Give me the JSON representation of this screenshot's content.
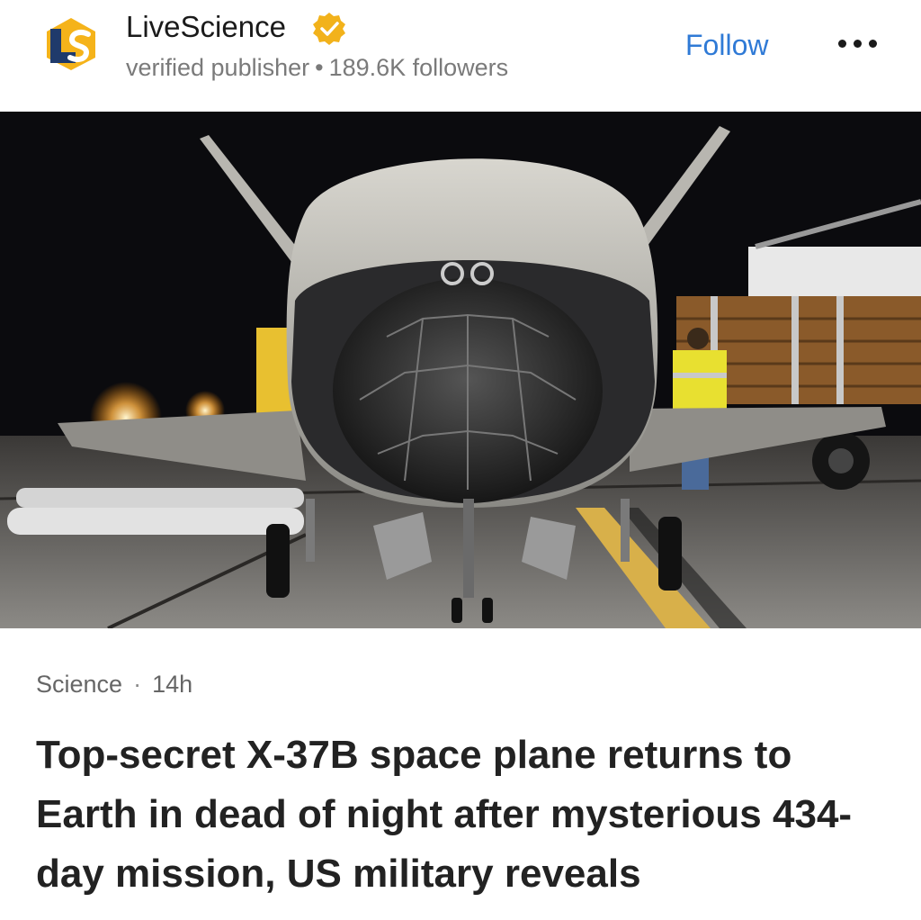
{
  "publisher": {
    "name": "LiveScience",
    "logo_icon": "livescience-logo",
    "verified_icon": "verified-badge-icon",
    "subtitle": "verified publisher",
    "separator": "•",
    "followers": "189.6K followers",
    "follow_label": "Follow",
    "more_icon": "more-horizontal-icon"
  },
  "image": {
    "description_icon": "article-hero-image"
  },
  "article": {
    "category": "Science",
    "separator": "·",
    "age": "14h",
    "headline": "Top-secret X-37B space plane returns to Earth in dead of night after mysterious 434-day mission, US military reveals"
  },
  "colors": {
    "accent": "#2f7ad6",
    "logo_blue": "#1f3a6b",
    "logo_yellow": "#f5b31a",
    "badge": "#f2b21b"
  }
}
